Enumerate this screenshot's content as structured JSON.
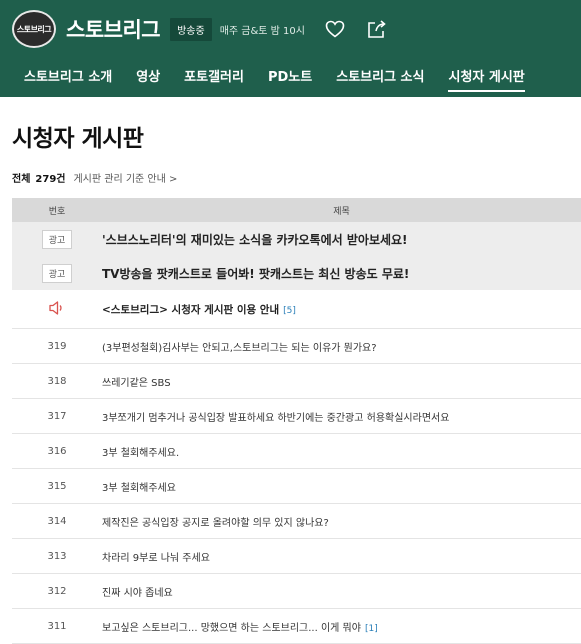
{
  "header": {
    "logo_text": "스토브리그",
    "title": "스토브리그",
    "onair_badge": "방송중",
    "schedule": "매주 금&토 밤 10시",
    "icons": [
      "heart-icon",
      "share-icon"
    ],
    "accent_color": "#1f5f4c"
  },
  "nav": {
    "items": [
      {
        "label": "스토브리그 소개"
      },
      {
        "label": "영상"
      },
      {
        "label": "포토갤러리"
      },
      {
        "label": "PD노트"
      },
      {
        "label": "스토브리그 소식"
      },
      {
        "label": "시청자 게시판",
        "active": true
      }
    ]
  },
  "page": {
    "title": "시청자 게시판",
    "total_label": "전체",
    "total_count": "279건",
    "guideline_link": "게시판 관리 기준 안내 >"
  },
  "table": {
    "headers": {
      "no": "번호",
      "title": "제목"
    },
    "ads": [
      {
        "badge": "광고",
        "subject": "'스브스노리터'의 재미있는 소식을 카카오톡에서 받아보세요!"
      },
      {
        "badge": "광고",
        "subject": "TV방송을 팟캐스트로 들어봐! 팟캐스트는 최신 방송도 무료!"
      }
    ],
    "notice": {
      "icon": "speaker-icon",
      "subject": "<스토브리그> 시청자 게시판 이용 안내",
      "replies": "[5]"
    },
    "posts": [
      {
        "no": "319",
        "subject": "(3부편성철회)김사부는 안되고,스토브리그는 되는 이유가 뭔가요?",
        "replies": ""
      },
      {
        "no": "318",
        "subject": "쓰레기같은 SBS",
        "replies": ""
      },
      {
        "no": "317",
        "subject": "3부쪼개기 멈추거나 공식입장 발표하세요 하반기에는 중간광고 허용확실시라면서요",
        "replies": ""
      },
      {
        "no": "316",
        "subject": "3부 철회해주세요.",
        "replies": ""
      },
      {
        "no": "315",
        "subject": "3부 철회해주세요",
        "replies": ""
      },
      {
        "no": "314",
        "subject": "제작진은 공식입장 공지로 올려야할 의무 있지 않나요?",
        "replies": ""
      },
      {
        "no": "313",
        "subject": "차라리 9부로 나눠 주세요",
        "replies": ""
      },
      {
        "no": "312",
        "subject": "진짜 시야 좁네요",
        "replies": ""
      },
      {
        "no": "311",
        "subject": "보고싶은 스토브리그... 망했으면 하는 스토브리그... 이게 뭐야",
        "replies": "[1]"
      }
    ]
  }
}
